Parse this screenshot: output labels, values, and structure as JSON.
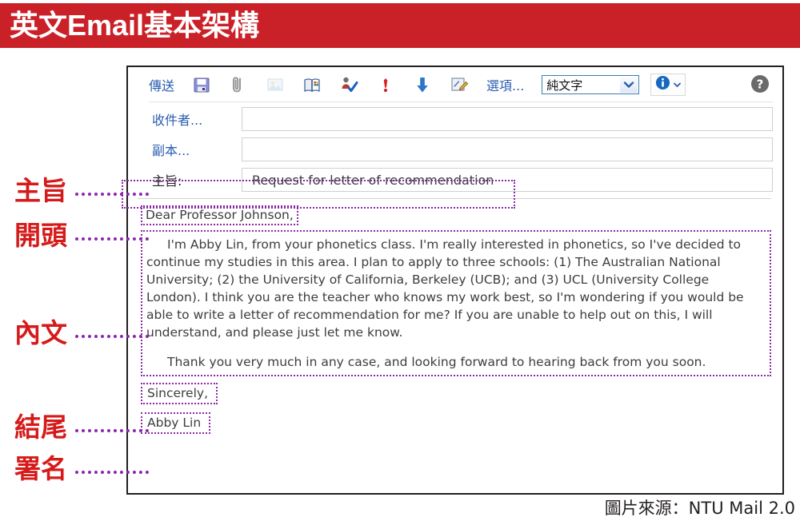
{
  "title": "英文Email基本架構",
  "colors": {
    "banner_red": "#ca2128",
    "annotation_red": "#d61a1a",
    "highlight_purple": "#8b27a8",
    "link_blue": "#2a5db0"
  },
  "toolbar": {
    "send_label": "傳送",
    "options_label": "選項...",
    "format_select_value": "純文字",
    "icons": [
      {
        "name": "save-icon",
        "title": "儲存"
      },
      {
        "name": "paperclip-attachment-icon",
        "title": "附加檔案"
      },
      {
        "name": "insert-image-icon",
        "title": "插入圖片"
      },
      {
        "name": "address-book-icon",
        "title": "通訊錄"
      },
      {
        "name": "spell-check-icon",
        "title": "拼字檢查"
      },
      {
        "name": "high-priority-icon",
        "title": "重要性"
      },
      {
        "name": "low-priority-down-arrow-icon",
        "title": "低重要性"
      },
      {
        "name": "signature-icon",
        "title": "簽名檔"
      },
      {
        "name": "info-icon",
        "title": "資訊"
      },
      {
        "name": "help-question-icon",
        "title": "說明"
      }
    ]
  },
  "fields": {
    "to_label": "收件者...",
    "to_value": "",
    "cc_label": "副本...",
    "cc_value": "",
    "subject_label": "主旨:",
    "subject_value": "Request for letter of recommendation"
  },
  "email": {
    "greeting": "Dear Professor Johnson,",
    "paragraph1": "I'm Abby Lin, from your phonetics class. I'm really interested in phonetics, so I've decided to continue my studies in this area. I plan to apply to three schools: (1) The Australian National University; (2) the University of California, Berkeley (UCB); and (3) UCL (University College London). I think you are the teacher who knows my work best, so I'm wondering if you would be able to write a letter of recommendation for me? If you are unable to help out on this, I will understand, and please just let me know.",
    "paragraph2": "Thank you very much in any case, and looking forward to hearing back from you soon.",
    "closing": "Sincerely,",
    "signature": "Abby Lin"
  },
  "annotations": [
    {
      "label": "主旨"
    },
    {
      "label": "開頭"
    },
    {
      "label": "內文"
    },
    {
      "label": "結尾"
    },
    {
      "label": "署名"
    }
  ],
  "caption": "圖片來源：NTU Mail 2.0"
}
